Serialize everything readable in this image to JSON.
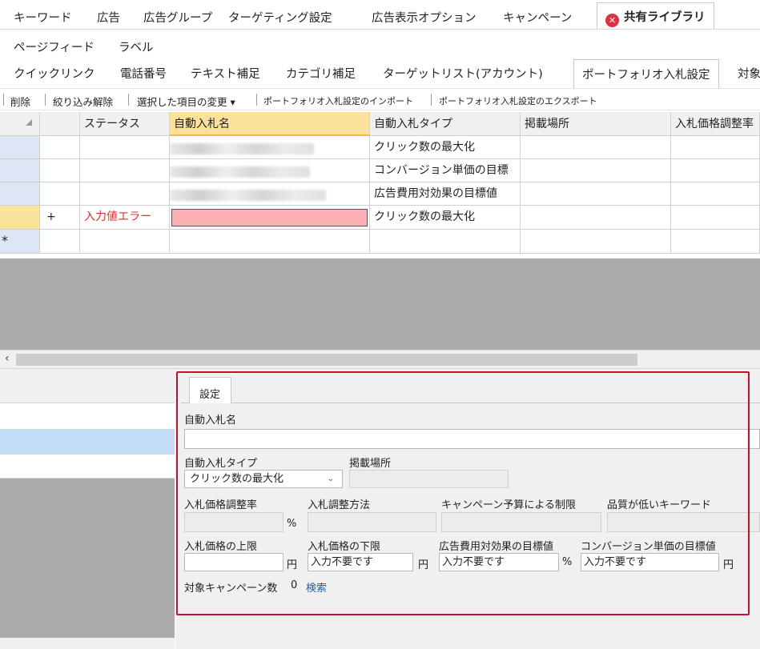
{
  "tabs_row1": [
    "キーワード",
    "広告",
    "広告グループ",
    "ターゲティング設定",
    "広告表示オプション",
    "キャンペーン",
    "共有ライブラリ"
  ],
  "tabs_row2": [
    "ページフィード",
    "ラベル"
  ],
  "tabs_row3": [
    "クイックリンク",
    "電話番号",
    "テキスト補足",
    "カテゴリ補足",
    "ターゲットリスト(アカウント)",
    "ポートフォリオ入札設定",
    "対象"
  ],
  "toolbar": {
    "delete": "削除",
    "clear_filter": "絞り込み解除",
    "change_selected": "選択した項目の変更 ▾",
    "import": "ポートフォリオ入札設定のインポート",
    "export": "ポートフォリオ入札設定のエクスポート"
  },
  "grid": {
    "columns": [
      "ステータス",
      "自動入札名",
      "自動入札タイプ",
      "掲載場所",
      "入札価格調整率"
    ],
    "rows": [
      {
        "marker": "",
        "status": "",
        "type": "クリック数の最大化"
      },
      {
        "marker": "",
        "status": "",
        "type": "コンバージョン単価の目標"
      },
      {
        "marker": "",
        "status": "",
        "type": "広告費用対効果の目標値"
      },
      {
        "marker": "+",
        "status": "入力値エラー",
        "type": "クリック数の最大化"
      },
      {
        "marker": "*",
        "status": "",
        "type": ""
      }
    ]
  },
  "scroll_arrow": "‹",
  "settings": {
    "tab": "設定",
    "bid_name_label": "自動入札名",
    "bid_name_value": "",
    "bid_type_label": "自動入札タイプ",
    "bid_type_value": "クリック数の最大化",
    "placement_label": "掲載場所",
    "adj_rate_label": "入札価格調整率",
    "adj_method_label": "入札調整方法",
    "budget_limit_label": "キャンペーン予算による制限",
    "low_quality_label": "品質が低いキーワード",
    "max_bid_label": "入札価格の上限",
    "min_bid_label": "入札価格の下限",
    "target_roas_label": "広告費用対効果の目標値",
    "target_cpa_label": "コンバージョン単価の目標値",
    "placeholder_value": "入力不要です",
    "unit_pct": "%",
    "unit_yen": "円",
    "target_campaigns_label": "対象キャンペーン数",
    "target_campaigns_count": "0",
    "search_link": "検索"
  },
  "colors": {
    "error_text": "#e0302e",
    "error_cell": "#ffb0b6",
    "highlight_border": "#c8102e",
    "link": "#1a5fb4"
  }
}
